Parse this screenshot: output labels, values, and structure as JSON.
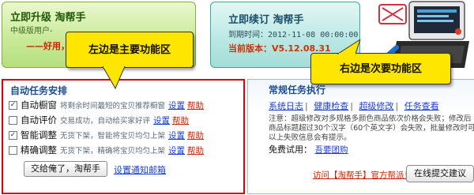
{
  "banner_upgrade": {
    "title": "立即升级 淘帮手",
    "subtitle": "中级版用户-",
    "cta": "好用，"
  },
  "banner_renew": {
    "title": "立即续订 淘帮手",
    "expire": "到期时间：2012-11-08 00:00:00",
    "version": "当前版本：V5.12.08.31"
  },
  "callouts": {
    "left": "左边是主要功能区",
    "right": "右边是次要功能区"
  },
  "main": {
    "heading": "自动任务安排",
    "tasks": [
      {
        "checked": true,
        "name": "自动橱窗",
        "desc": "将剩余时间最短的宝贝推荐橱窗",
        "settings": "设置",
        "help": "帮助"
      },
      {
        "checked": false,
        "name": "自动评价",
        "desc": "交易成功，自动给买家好评",
        "settings": "设置",
        "help": "帮助"
      },
      {
        "checked": true,
        "name": "智能调整",
        "desc": "无货下架，智能将宝贝均匀上架",
        "settings": "设置",
        "help": "帮助"
      },
      {
        "checked": false,
        "name": "精确调整",
        "desc": "无货下架，精确将宝贝均匀上架",
        "settings": "设置",
        "help": "帮助"
      }
    ],
    "submit_button": "交给俺了，淘帮手",
    "notify_link": "设置通知邮箱"
  },
  "secondary": {
    "heading": "常规任务执行",
    "nav": [
      "系统日志",
      "健康检查",
      "超级修改",
      "任务查看"
    ],
    "note_lines": [
      "注意：超级修改对多规格多颜色商品依次价格会失败；修改后",
      "商品标题超过30个汉字（60个英文字）会失败，批量修改时可",
      "以上失败信息会有提示。"
    ],
    "trial_label": "免费试用：",
    "trial_link": "吾要团购",
    "visit_link": "访问【淘帮手】官方帮派！",
    "feedback_button": "在线提交建议"
  },
  "colors": {
    "main_border": "#d6000a",
    "callout": "#ffe600",
    "link": "#1a3fcf",
    "accent_red": "#cc2200"
  }
}
